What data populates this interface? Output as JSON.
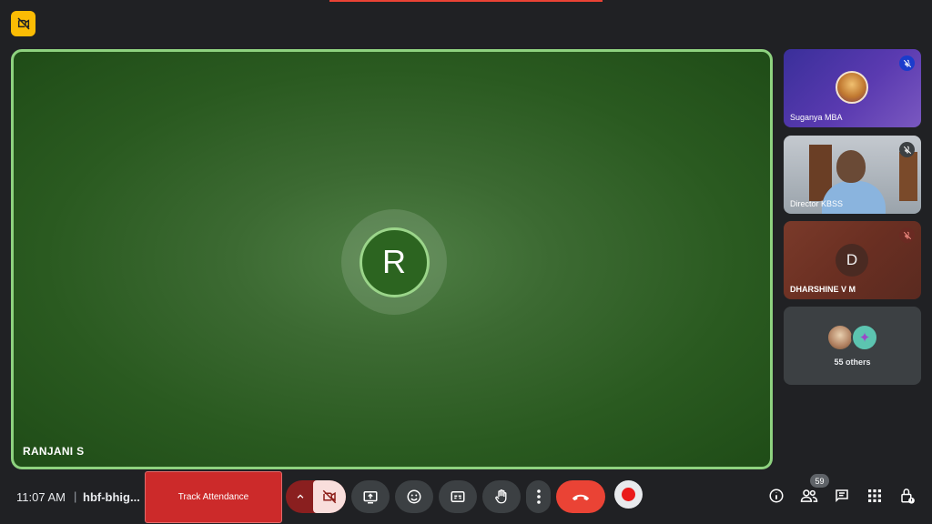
{
  "main_tile": {
    "avatar_letter": "R",
    "participant_name": "RANJANI S"
  },
  "side_tiles": [
    {
      "name": "Suganya MBA",
      "muted": true
    },
    {
      "name": "Director KBSS",
      "muted": true
    },
    {
      "name": "DHARSHINE V M",
      "avatar_letter": "D",
      "muted": true
    }
  ],
  "others_tile": {
    "label": "55 others"
  },
  "bottom_bar": {
    "time": "11:07 AM",
    "separator": "|",
    "meeting_code": "hbf-bhig...",
    "track_attendance_label": "Track Attendance",
    "participant_count": "59"
  },
  "icons": {
    "corner_badge": "camera-off-icon",
    "camera": "camera-off-icon",
    "present": "present-screen-icon",
    "emoji": "emoji-icon",
    "captions": "captions-icon",
    "raise_hand": "raise-hand-icon",
    "more": "more-options-icon",
    "end_call": "end-call-icon",
    "record": "record-icon",
    "info": "info-icon",
    "people": "people-icon",
    "chat": "chat-icon",
    "activities": "apps-grid-icon",
    "host_controls": "host-controls-icon"
  },
  "colors": {
    "active_speaker_border": "#8ed27f",
    "end_call": "#ea4335",
    "track_attendance": "#cc2a2a"
  }
}
